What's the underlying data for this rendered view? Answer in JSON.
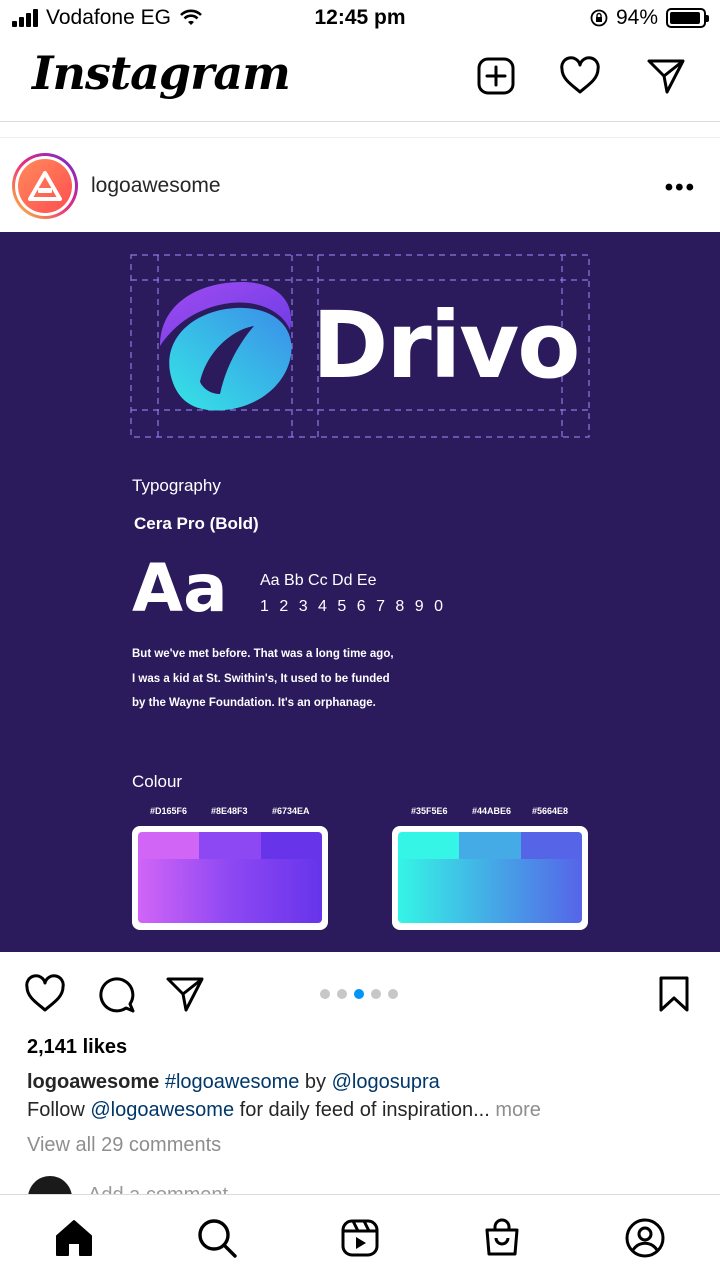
{
  "status_bar": {
    "carrier": "Vodafone EG",
    "time": "12:45 pm",
    "battery": "94%",
    "battery_level": 0.94
  },
  "header": {
    "app_title": "Instagram",
    "icons": [
      "new-post-icon",
      "heart-icon",
      "direct-message-icon"
    ]
  },
  "post": {
    "username": "logoawesome",
    "image": {
      "brand_name": "Drivo",
      "typography_label": "Typography",
      "font_name": "Cera Pro (Bold)",
      "sample_glyph": "Aa",
      "alphabet": "Aa Bb Cc Dd Ee",
      "digits": "1 2 3 4 5 6 7 8 9 0",
      "sample_text": [
        "But we've met before. That was a long time ago,",
        "I was a kid at St. Swithin's, It used to be funded",
        "by the Wayne Foundation. It's an orphanage."
      ],
      "colour_label": "Colour",
      "palette_1": [
        "#D165F6",
        "#8E48F3",
        "#6734EA"
      ],
      "palette_2": [
        "#35F5E6",
        "#44ABE6",
        "#5664E8"
      ],
      "background_color": "#2b1a5c"
    },
    "carousel": {
      "count": 5,
      "active_index": 2
    },
    "likes": "2,141 likes",
    "caption": {
      "username": "logoawesome",
      "hashtag": "#logoawesome",
      "by": "by",
      "credit": "@logosupra",
      "follow_prefix": "Follow",
      "mention": "@logoawesome",
      "follow_suffix": " for daily feed of inspiration...",
      "more": "more"
    },
    "comments_link": "View all 29 comments",
    "add_comment_placeholder": "Add a comment..."
  },
  "colors": {
    "link": "#00376b",
    "active_dot": "#0095f6",
    "muted": "#8e8e8e"
  },
  "bottom_nav": [
    "home-icon",
    "search-icon",
    "reels-icon",
    "shop-icon",
    "profile-icon"
  ]
}
